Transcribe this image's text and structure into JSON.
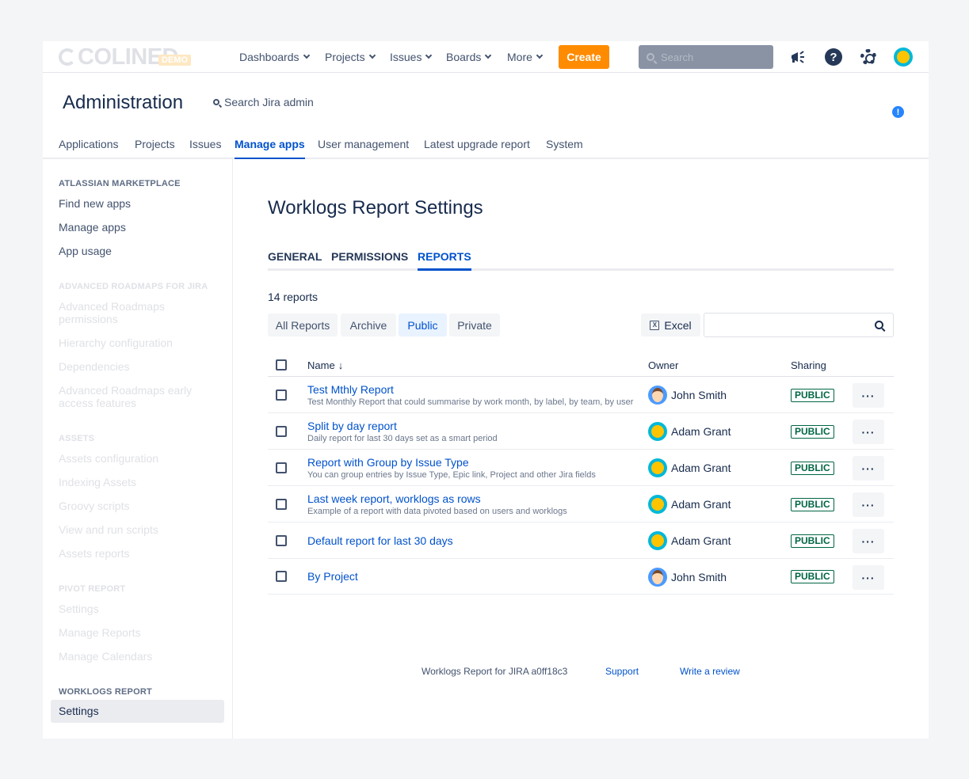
{
  "topnav": {
    "logo_text": "COLINED",
    "logo_badge": "DEMO",
    "items": [
      "Dashboards",
      "Projects",
      "Issues",
      "Boards",
      "More"
    ],
    "create_label": "Create",
    "search_placeholder": "Search"
  },
  "admin": {
    "title": "Administration",
    "search_label": "Search Jira admin",
    "tabs": [
      "Applications",
      "Projects",
      "Issues",
      "Manage apps",
      "User management",
      "Latest upgrade report",
      "System"
    ],
    "active_tab": "Manage apps"
  },
  "sidebar": {
    "sections": [
      {
        "heading": "ATLASSIAN MARKETPLACE",
        "items": [
          "Find new apps",
          "Manage apps",
          "App usage"
        ]
      },
      {
        "heading": "ADVANCED ROADMAPS FOR JIRA",
        "items": [
          "Advanced Roadmaps permissions",
          "Hierarchy configuration",
          "Dependencies",
          "Advanced Roadmaps early access features"
        ]
      },
      {
        "heading": "ASSETS",
        "items": [
          "Assets configuration",
          "Indexing Assets",
          "Groovy scripts",
          "View and run scripts",
          "Assets reports"
        ]
      },
      {
        "heading": "PIVOT REPORT",
        "items": [
          "Settings",
          "Manage Reports",
          "Manage Calendars"
        ]
      },
      {
        "heading": "WORKLOGS REPORT",
        "items": [
          "Settings"
        ]
      }
    ]
  },
  "main": {
    "title": "Worklogs Report Settings",
    "tabs": [
      "GENERAL",
      "PERMISSIONS",
      "REPORTS"
    ],
    "active_tab": "REPORTS",
    "count_label": "14 reports",
    "filters": [
      "All Reports",
      "Archive",
      "Public",
      "Private"
    ],
    "active_filter": "Public",
    "excel_label": "Excel",
    "table": {
      "headers": {
        "name": "Name",
        "owner": "Owner",
        "sharing": "Sharing"
      },
      "rows": [
        {
          "name": "Test Mthly Report",
          "desc": "Test Monthly Report that could summarise by work month, by label, by team, by user",
          "owner": "John Smith",
          "avatar": "blue",
          "sharing": "PUBLIC"
        },
        {
          "name": "Split by day report",
          "desc": "Daily report for last 30 days set as a smart period",
          "owner": "Adam Grant",
          "avatar": "yellow",
          "sharing": "PUBLIC"
        },
        {
          "name": "Report with Group by Issue Type",
          "desc": "You can group entries by Issue Type, Epic link, Project and other Jira fields",
          "owner": "Adam Grant",
          "avatar": "yellow",
          "sharing": "PUBLIC"
        },
        {
          "name": "Last week report, worklogs as rows",
          "desc": "Example of a report with data pivoted based on users and worklogs",
          "owner": "Adam Grant",
          "avatar": "yellow",
          "sharing": "PUBLIC"
        },
        {
          "name": "Default report for last 30 days",
          "desc": "",
          "owner": "Adam Grant",
          "avatar": "yellow",
          "sharing": "PUBLIC"
        },
        {
          "name": "By Project",
          "desc": "",
          "owner": "John Smith",
          "avatar": "blue",
          "sharing": "PUBLIC"
        }
      ]
    },
    "footer": {
      "version": "Worklogs Report for JIRA a0ff18c3",
      "support": "Support",
      "review": "Write a review"
    }
  },
  "colors": {
    "accent": "#0052cc",
    "create": "#ff8b00",
    "public_badge": "#006644"
  }
}
